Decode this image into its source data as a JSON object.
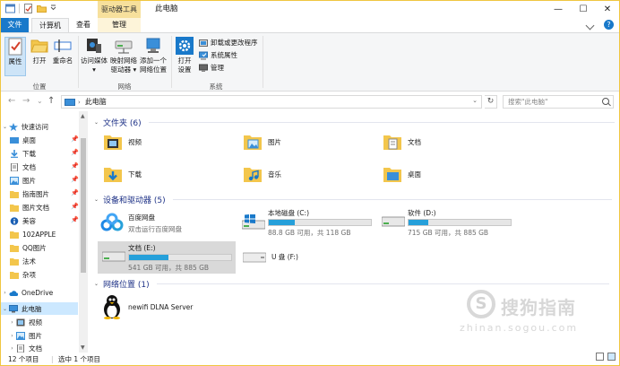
{
  "titlebar": {
    "contextual_tab": "驱动器工具",
    "title": "此电脑",
    "minimize": "—",
    "maximize": "☐",
    "close": "✕"
  },
  "tabs": {
    "file": "文件",
    "computer": "计算机",
    "view": "查看",
    "manage": "管理",
    "help": "?"
  },
  "ribbon": {
    "properties": "属性",
    "open": "打开",
    "rename": "重命名",
    "access_media_1": "访问媒体",
    "access_media_2": "▾",
    "map_drive_1": "映射网络",
    "map_drive_2": "驱动器 ▾",
    "add_netloc_1": "添加一个",
    "add_netloc_2": "网络位置",
    "open_settings_1": "打开",
    "open_settings_2": "设置",
    "uninstall": "卸载或更改程序",
    "sys_props": "系统属性",
    "manage": "管理",
    "group_location": "位置",
    "group_network": "网络",
    "group_system": "系统"
  },
  "navbar": {
    "back": "←",
    "forward": "→",
    "recent": "⌄",
    "up": "↑",
    "sep": "›",
    "address": "此电脑",
    "dropdown": "⌄",
    "refresh": "↻",
    "search_placeholder": "搜索\"此电脑\""
  },
  "navpane": {
    "quick_access": "快速访问",
    "items": [
      {
        "label": "桌面",
        "pin": "📌"
      },
      {
        "label": "下载",
        "pin": "📌"
      },
      {
        "label": "文档",
        "pin": "📌"
      },
      {
        "label": "图片",
        "pin": "📌"
      },
      {
        "label": "指南图片",
        "pin": "📌"
      },
      {
        "label": "图片文档",
        "pin": "📌"
      },
      {
        "label": "美容",
        "pin": "📌"
      },
      {
        "label": "102APPLE"
      },
      {
        "label": "QQ图片"
      },
      {
        "label": "法术"
      },
      {
        "label": "杂项"
      }
    ],
    "onedrive": "OneDrive",
    "this_pc": "此电脑",
    "pc_children": [
      "视频",
      "图片",
      "文档"
    ]
  },
  "content": {
    "folders_header": "文件夹 (6)",
    "folders": [
      "视频",
      "图片",
      "文档",
      "下载",
      "音乐",
      "桌面"
    ],
    "devices_header": "设备和驱动器 (5)",
    "baidu": {
      "name": "百度网盘",
      "sub": "双击运行百度网盘"
    },
    "drives": [
      {
        "name": "本地磁盘 (C:)",
        "size": "88.8 GB 可用，共 118 GB",
        "used": 0.25
      },
      {
        "name": "软件 (D:)",
        "size": "715 GB 可用，共 885 GB",
        "used": 0.19
      },
      {
        "name": "文档 (E:)",
        "size": "541 GB 可用，共 885 GB",
        "used": 0.39
      }
    ],
    "usb": "U 盘 (F:)",
    "network_header": "网络位置 (1)",
    "dlna": "newifi DLNA Server"
  },
  "status": {
    "count": "12 个项目",
    "selected": "选中 1 个项目"
  },
  "watermark": {
    "text": "搜狗指南",
    "url": "zhinan.sogou.com"
  },
  "colors": {
    "accent": "#1979ca",
    "drive_fill": "#26a0da",
    "selection": "#cce8ff",
    "folder": "#f3c64c"
  }
}
